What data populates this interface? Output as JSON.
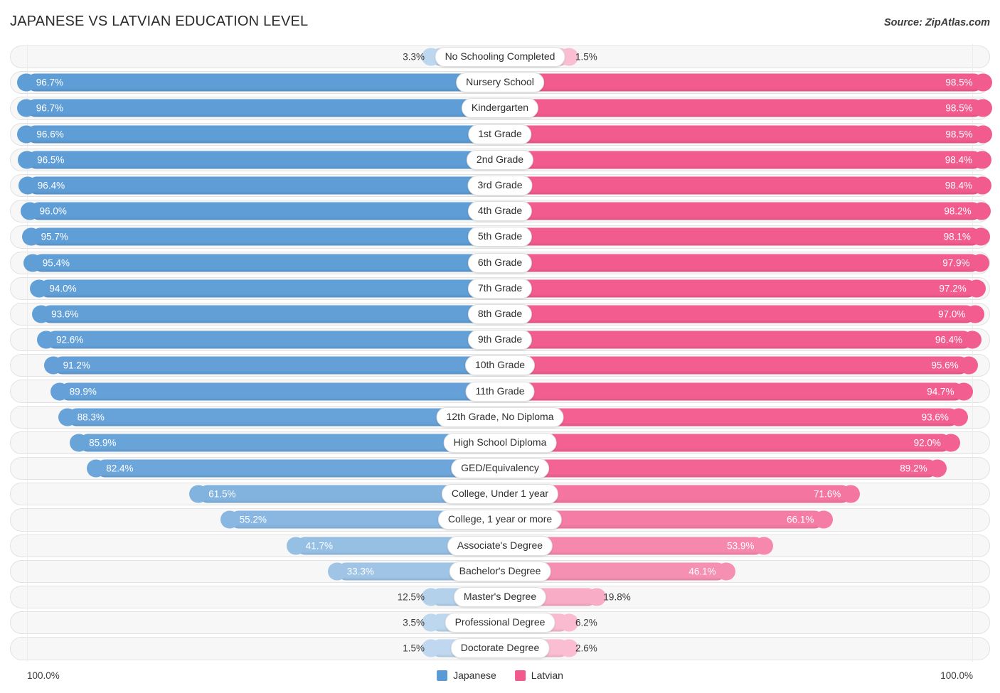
{
  "header": {
    "title": "JAPANESE VS LATVIAN EDUCATION LEVEL",
    "source": "Source: ZipAtlas.com"
  },
  "legend": {
    "series": [
      {
        "label": "Japanese",
        "color": "#5b9bd5"
      },
      {
        "label": "Latvian",
        "color": "#f2598c"
      }
    ]
  },
  "axis": {
    "left_max": "100.0%",
    "right_max": "100.0%"
  },
  "chart_data": {
    "type": "bar",
    "orientation": "horizontal-diverging",
    "title": "JAPANESE VS LATVIAN EDUCATION LEVEL",
    "xlabel": "",
    "ylabel": "",
    "xlim": [
      0,
      100
    ],
    "grid": false,
    "legend_position": "bottom-center",
    "categories": [
      "No Schooling Completed",
      "Nursery School",
      "Kindergarten",
      "1st Grade",
      "2nd Grade",
      "3rd Grade",
      "4th Grade",
      "5th Grade",
      "6th Grade",
      "7th Grade",
      "8th Grade",
      "9th Grade",
      "10th Grade",
      "11th Grade",
      "12th Grade, No Diploma",
      "High School Diploma",
      "GED/Equivalency",
      "College, Under 1 year",
      "College, 1 year or more",
      "Associate's Degree",
      "Bachelor's Degree",
      "Master's Degree",
      "Professional Degree",
      "Doctorate Degree"
    ],
    "series": [
      {
        "name": "Japanese",
        "color": "#5b9bd5",
        "values": [
          3.3,
          96.7,
          96.7,
          96.6,
          96.5,
          96.4,
          96.0,
          95.7,
          95.4,
          94.0,
          93.6,
          92.6,
          91.2,
          89.9,
          88.3,
          85.9,
          82.4,
          61.5,
          55.2,
          41.7,
          33.3,
          12.5,
          3.5,
          1.5
        ],
        "labels": [
          "3.3%",
          "96.7%",
          "96.7%",
          "96.6%",
          "96.5%",
          "96.4%",
          "96.0%",
          "95.7%",
          "95.4%",
          "94.0%",
          "93.6%",
          "92.6%",
          "91.2%",
          "89.9%",
          "88.3%",
          "85.9%",
          "82.4%",
          "61.5%",
          "55.2%",
          "41.7%",
          "33.3%",
          "12.5%",
          "3.5%",
          "1.5%"
        ]
      },
      {
        "name": "Latvian",
        "color": "#f2598c",
        "values": [
          1.5,
          98.5,
          98.5,
          98.5,
          98.4,
          98.4,
          98.2,
          98.1,
          97.9,
          97.2,
          97.0,
          96.4,
          95.6,
          94.7,
          93.6,
          92.0,
          89.2,
          71.6,
          66.1,
          53.9,
          46.1,
          19.8,
          6.2,
          2.6
        ],
        "labels": [
          "1.5%",
          "98.5%",
          "98.5%",
          "98.5%",
          "98.4%",
          "98.4%",
          "98.2%",
          "98.1%",
          "97.9%",
          "97.2%",
          "97.0%",
          "96.4%",
          "95.6%",
          "94.7%",
          "93.6%",
          "92.0%",
          "89.2%",
          "71.6%",
          "66.1%",
          "53.9%",
          "46.1%",
          "19.8%",
          "6.2%",
          "2.6%"
        ]
      }
    ]
  }
}
